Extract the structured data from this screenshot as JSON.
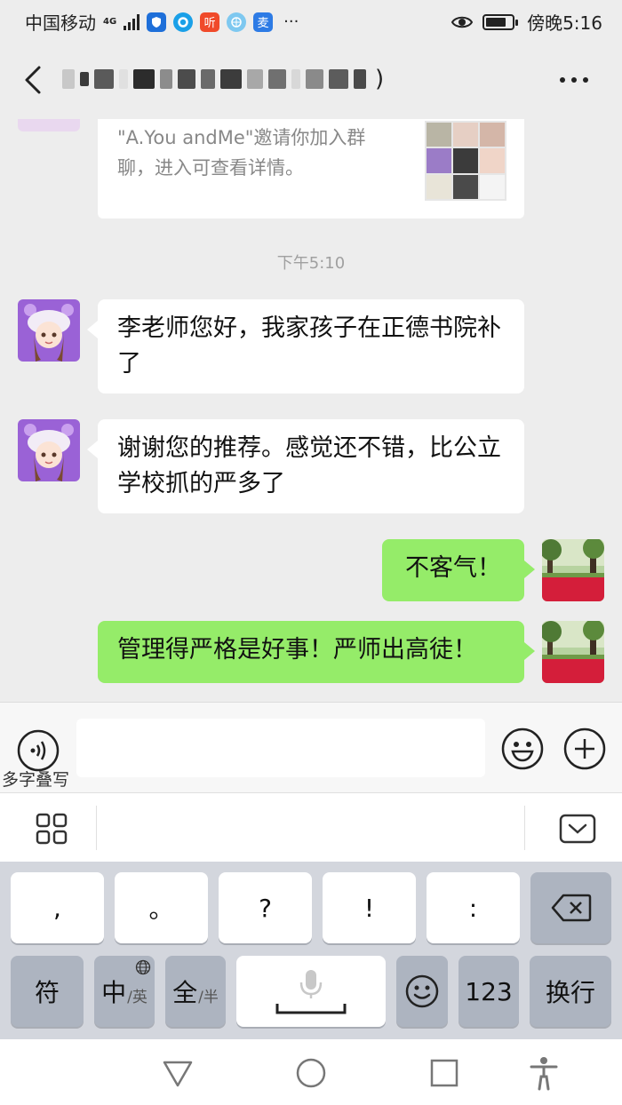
{
  "status_bar": {
    "carrier": "中国移动",
    "network": "4G",
    "app_icon_listen": "听",
    "app_icon_other": "麦",
    "time": "傍晚5:16"
  },
  "chat": {
    "title_suffix": ")",
    "invite_card": {
      "text": "\"A.You andMe\"邀请你加入群聊，进入可查看详情。"
    },
    "timestamp": "下午5:10",
    "messages": [
      {
        "side": "in",
        "text": "李老师您好，我家孩子在正德书院补了"
      },
      {
        "side": "in",
        "text": "谢谢您的推荐。感觉还不错，比公立学校抓的严多了"
      },
      {
        "side": "out",
        "text": "不客气！"
      },
      {
        "side": "out",
        "text": "管理得严格是好事！严师出高徒！"
      }
    ]
  },
  "input_bar": {
    "handwrite_label": "多字叠写",
    "message_value": ""
  },
  "keyboard": {
    "row1": [
      ",",
      "。",
      "?",
      "!",
      ":"
    ],
    "row2": {
      "symbols": "符",
      "lang_main": "中",
      "lang_sub": "/英",
      "width_main": "全",
      "width_sub": "/半",
      "numbers": "123",
      "newline": "换行"
    }
  },
  "colors": {
    "bubble_out": "#95ec69",
    "bubble_in": "#ffffff",
    "background": "#ededed"
  },
  "icons": [
    "back-icon",
    "more-icon",
    "voice-icon",
    "emoji-icon",
    "plus-icon",
    "grid-icon",
    "hide-keyboard-icon",
    "backspace-icon",
    "microphone-icon",
    "smiley-icon",
    "globe-icon",
    "nav-back-icon",
    "nav-home-icon",
    "nav-recents-icon",
    "accessibility-icon"
  ]
}
